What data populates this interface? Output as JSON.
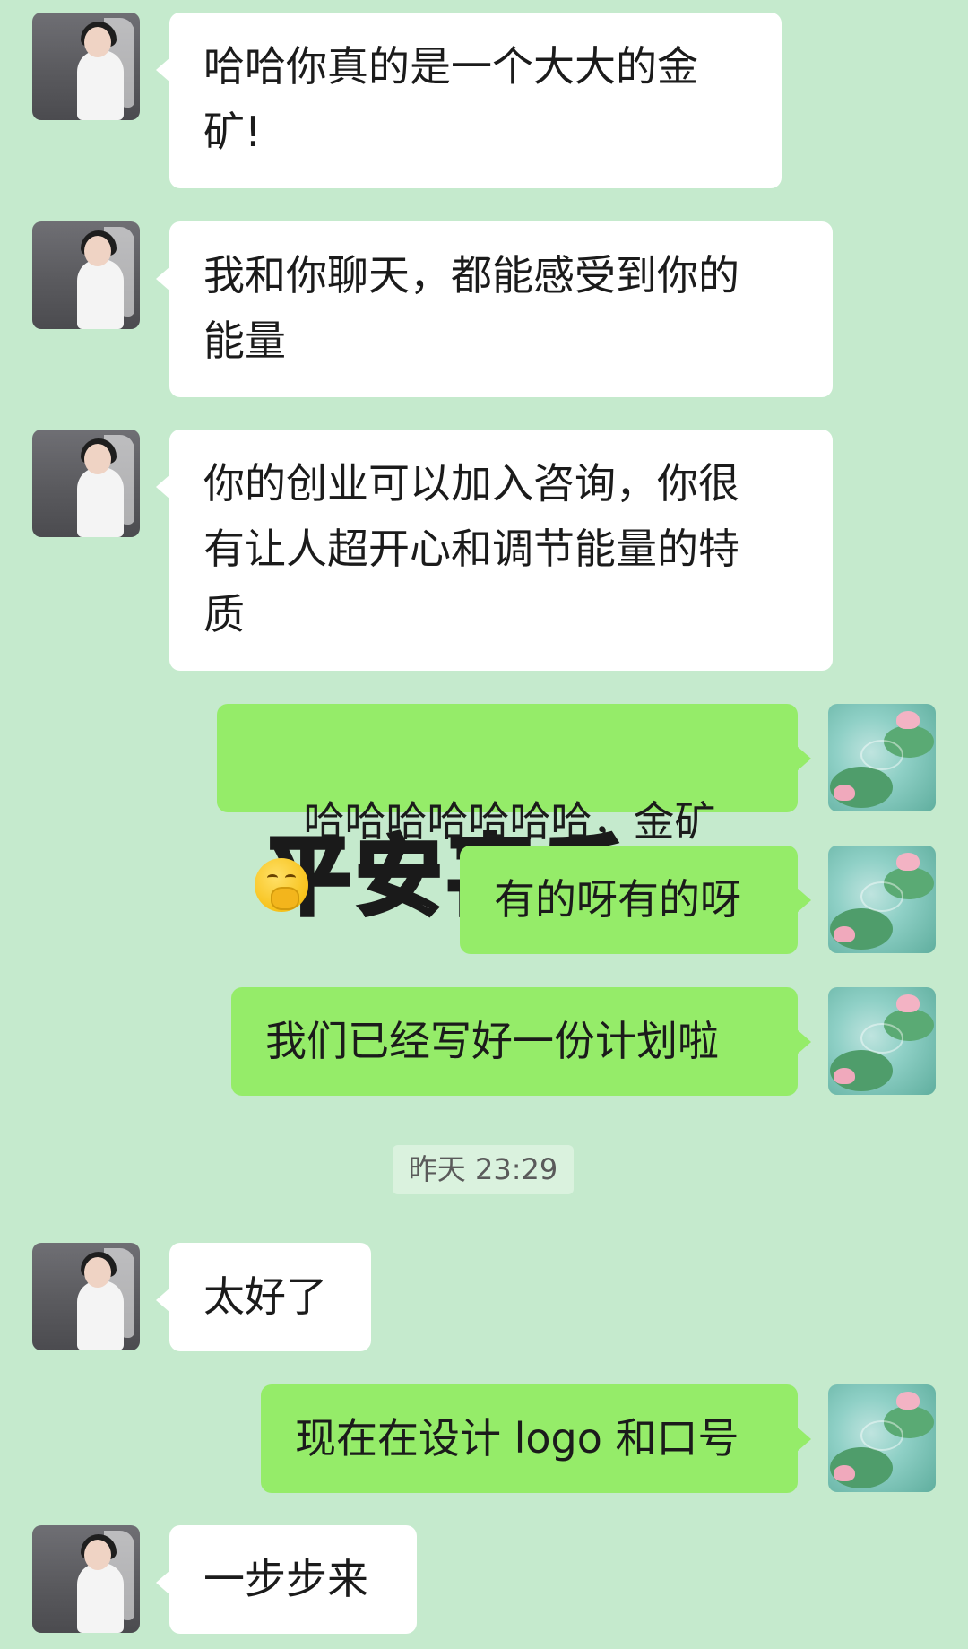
{
  "messages": [
    {
      "sender": "contact",
      "text": "哈哈你真的是一个大大的金\n矿!"
    },
    {
      "sender": "contact",
      "text": "我和你聊天，都能感受到你的\n能量"
    },
    {
      "sender": "contact",
      "text": "你的创业可以加入咨询，你很\n有让人超开心和调节能量的特\n质"
    },
    {
      "sender": "me",
      "text": "哈哈哈哈哈哈哈，金矿",
      "emoji": "thinking-face-emoji"
    },
    {
      "sender": "me",
      "text": "有的呀有的呀"
    },
    {
      "sender": "me",
      "text": "我们已经写好一份计划啦"
    },
    {
      "sender": "contact",
      "text": "太好了"
    },
    {
      "sender": "me",
      "text": "现在在设计 logo 和口号"
    },
    {
      "sender": "contact",
      "text": "一步步来"
    }
  ],
  "timestamp": "昨天 23:29",
  "background_text": "平安喜乐",
  "colors": {
    "chat_background": "#c5eacd",
    "incoming_bubble": "#ffffff",
    "outgoing_bubble": "#95ec69",
    "timestamp_chip": "#daf2de"
  }
}
